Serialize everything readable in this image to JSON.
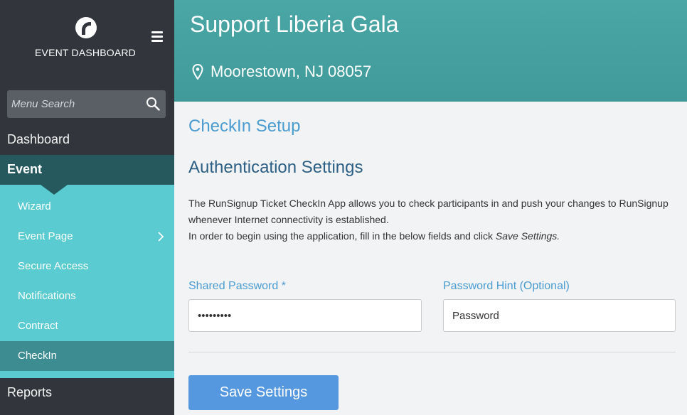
{
  "sidebar": {
    "title": "EVENT DASHBOARD",
    "search_placeholder": "Menu Search",
    "nav": {
      "dashboard": "Dashboard",
      "event": "Event",
      "reports": "Reports"
    },
    "submenu": [
      {
        "label": "Wizard"
      },
      {
        "label": "Event Page"
      },
      {
        "label": "Secure Access"
      },
      {
        "label": "Notifications"
      },
      {
        "label": "Contract"
      },
      {
        "label": "CheckIn"
      }
    ]
  },
  "header": {
    "title": "Support Liberia Gala",
    "location": "Moorestown, NJ 08057"
  },
  "main": {
    "section_title": "CheckIn Setup",
    "sub_title": "Authentication Settings",
    "description_line1": "The RunSignup Ticket CheckIn App allows you to check participants in and push your changes to RunSignup whenever Internet connectivity is established.",
    "description_line2": "In order to begin using the application, fill in the below fields and click ",
    "description_em": "Save Settings.",
    "shared_password_label": "Shared Password *",
    "shared_password_value": "•••••••••",
    "password_hint_label": "Password Hint (Optional)",
    "password_hint_value": "Password",
    "save_button": "Save Settings"
  },
  "colors": {
    "sidebar_bg": "#32363c",
    "event_active": "#25595d",
    "submenu_bg": "#5acbd0",
    "submenu_active": "#3c8c92",
    "header_bg": "#45a1a0",
    "accent_blue": "#4a9cd1",
    "button_blue": "#5598e0"
  }
}
